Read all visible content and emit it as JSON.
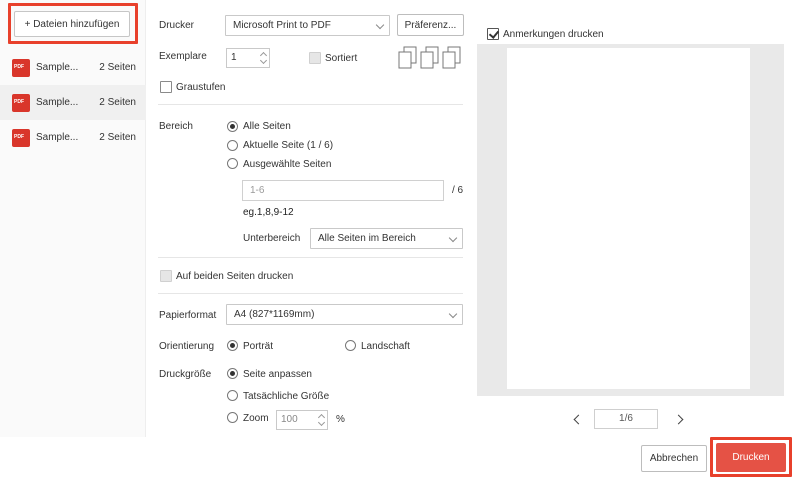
{
  "files": {
    "add_button": "+ Dateien hinzufügen",
    "items": [
      {
        "icon_text": "PDF",
        "name": "Sample...",
        "pages": "2 Seiten"
      },
      {
        "icon_text": "PDF",
        "name": "Sample...",
        "pages": "2 Seiten"
      },
      {
        "icon_text": "PDF",
        "name": "Sample...",
        "pages": "2 Seiten"
      }
    ]
  },
  "printer": {
    "label": "Drucker",
    "selected": "Microsoft Print to PDF",
    "preferences_button": "Präferenz..."
  },
  "copies": {
    "label": "Exemplare",
    "value": "1",
    "collate_label": "Sortiert",
    "collate_checked": false
  },
  "grayscale": {
    "label": "Graustufen",
    "checked": false
  },
  "range": {
    "label": "Bereich",
    "options": [
      "Alle Seiten",
      "Aktuelle Seite (1 / 6)",
      "Ausgewählte Seiten"
    ],
    "selected": "Alle Seiten",
    "pages_placeholder": "1-6",
    "pages_total": "/ 6",
    "example": "eg.1,8,9-12",
    "subrange_label": "Unterbereich",
    "subrange_selected": "Alle Seiten im Bereich"
  },
  "duplex": {
    "label": "Auf beiden Seiten drucken",
    "checked": false
  },
  "paper": {
    "label": "Papierformat",
    "selected": "A4 (827*1169mm)"
  },
  "orientation": {
    "label": "Orientierung",
    "portrait": "Porträt",
    "landscape": "Landschaft",
    "selected": "Porträt"
  },
  "print_size": {
    "label": "Druckgröße",
    "options": [
      "Seite anpassen",
      "Tatsächliche Größe",
      "Zoom"
    ],
    "selected": "Seite anpassen",
    "zoom_value": "100",
    "zoom_unit": "%"
  },
  "preview": {
    "annotations_label": "Anmerkungen drucken",
    "annotations_checked": true,
    "page_indicator": "1/6"
  },
  "actions": {
    "cancel": "Abbrechen",
    "print": "Drucken"
  },
  "colors": {
    "accent": "#e55245",
    "highlight": "#e8402b",
    "pdf_icon": "#d9362b"
  }
}
